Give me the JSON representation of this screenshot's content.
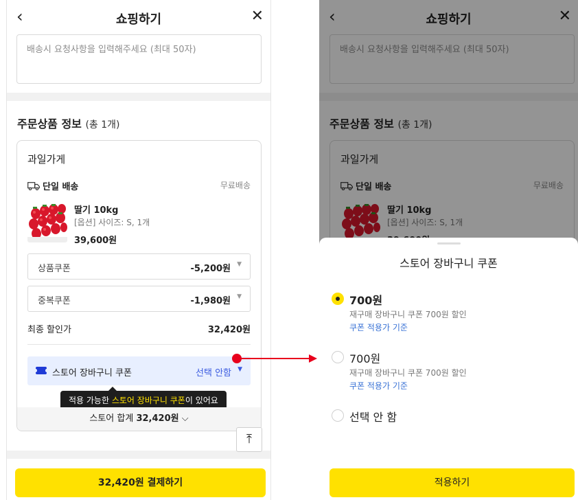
{
  "header": {
    "title": "쇼핑하기",
    "back_icon": "‹",
    "close_icon": "✕"
  },
  "memo": {
    "placeholder": "배송시 요청사항을 입력해주세요 (최대 50자)"
  },
  "order_section": {
    "title": "주문상품 정보",
    "count": "(총 1개)"
  },
  "store": {
    "name": "과일가게",
    "shipping_label": "단일 배송",
    "shipping_fee": "무료배송",
    "product": {
      "name": "딸기 10kg",
      "option": "[옵션] 사이즈: S, 1개",
      "price": "39,600원"
    },
    "coupons": [
      {
        "label": "상품쿠폰",
        "amount": "-5,200원"
      },
      {
        "label": "중복쿠폰",
        "amount": "-1,980원"
      }
    ],
    "final_label": "최종 할인가",
    "final_value": "32,420원",
    "basket_coupon": {
      "label": "스토어 장바구니 쿠폰",
      "selected": "선택 안함"
    },
    "tooltip": {
      "prefix": "적용 가능한 ",
      "highlight": "스토어 장바구니 쿠폰",
      "suffix": "이 있어요"
    },
    "total": {
      "label": "스토어 합계",
      "value": "32,420원"
    }
  },
  "top_button": "⤒",
  "pay_button": "32,420원 결제하기",
  "sheet": {
    "title": "스토어 장바구니 쿠폰",
    "options": [
      {
        "title": "700원",
        "desc": "재구매 장바구니 쿠폰 700원 할인",
        "link": "쿠폰 적용가 기준",
        "selected": true
      },
      {
        "title": "700원",
        "desc": "재구매 장바구니 쿠폰 700원 할인",
        "link": "쿠폰 적용가 기준",
        "selected": false
      },
      {
        "title": "선택 안 함",
        "selected": false
      }
    ],
    "apply_button": "적용하기"
  },
  "colors": {
    "accent_yellow": "#ffe100",
    "link_blue": "#3a73d6",
    "arrow_red": "#e8001c",
    "basket_bg": "#e8efff"
  }
}
